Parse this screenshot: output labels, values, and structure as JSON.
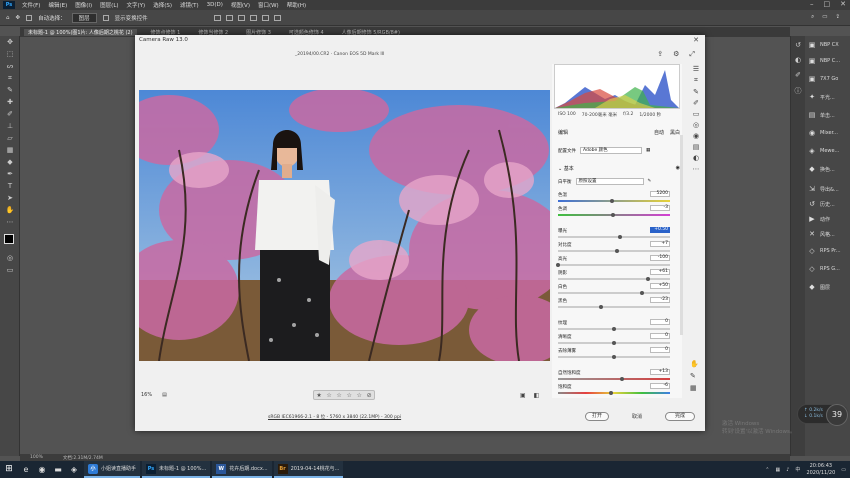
{
  "ps": {
    "menu": [
      "文件(F)",
      "编辑(E)",
      "图像(I)",
      "图层(L)",
      "文字(Y)",
      "选择(S)",
      "滤镜(T)",
      "3D(D)",
      "视图(V)",
      "窗口(W)",
      "帮助(H)"
    ],
    "logo": "Ps",
    "options": {
      "auto_select": "自动选择：",
      "group": "图层",
      "show_transform": "显示变换控件"
    },
    "tabs": [
      "未标题-1 @ 100%(图1片: 人像后期之桃花 (2)",
      "修饰点修饰 1",
      "修饰当修饰 2",
      "图片修饰 3",
      "可选颜色修饰 4",
      "人像后期修饰 5/RGB/8#)"
    ],
    "status": {
      "zoom": "100%",
      "doc": "文档:2.31M/2.74M"
    },
    "panels": [
      "NBP CX",
      "NBP C...",
      "7X7 Go",
      "平光...",
      "单击...",
      "Mixer...",
      "Mewe...",
      "换色...",
      "导出&...",
      "历史...",
      "动作",
      "风格...",
      "RPS Pr...",
      "RPS G...",
      "图层"
    ]
  },
  "acr": {
    "title": "Camera Raw 13.0",
    "subtitle": "_20194/00.CR2  ·  Canon EOS 5D Mark III",
    "meta": [
      "ISO 100",
      "70-200毫米 毫米",
      "f/3.2",
      "1/2000 秒"
    ],
    "edit_label": "编辑",
    "auto_label": "自动",
    "bw_label": "黑白",
    "profile_label": "配置文件",
    "profile_value": "Adobe 颜色",
    "basic_label": "基本",
    "wb_label": "白平衡",
    "wb_value": "原照设置",
    "sliders": {
      "temp": {
        "label": "色温",
        "value": "5200",
        "pos": 0.48
      },
      "tint": {
        "label": "色调",
        "value": "-3",
        "pos": 0.49
      },
      "exposure": {
        "label": "曝光",
        "value": "+0.50",
        "pos": 0.55
      },
      "contrast": {
        "label": "对比度",
        "value": "+7",
        "pos": 0.53
      },
      "highlights": {
        "label": "高光",
        "value": "-100",
        "pos": 0.0
      },
      "shadows": {
        "label": "阴影",
        "value": "+61",
        "pos": 0.8
      },
      "whites": {
        "label": "白色",
        "value": "+50",
        "pos": 0.75
      },
      "blacks": {
        "label": "黑色",
        "value": "-23",
        "pos": 0.38
      },
      "texture": {
        "label": "纹理",
        "value": "0",
        "pos": 0.5
      },
      "clarity": {
        "label": "清晰度",
        "value": "0",
        "pos": 0.5
      },
      "dehaze": {
        "label": "去除薄雾",
        "value": "0",
        "pos": 0.5
      },
      "vibrance": {
        "label": "自然饱和度",
        "value": "+13",
        "pos": 0.57
      },
      "saturation": {
        "label": "饱和度",
        "value": "-6",
        "pos": 0.47
      }
    },
    "zoom": "16%",
    "fileinfo": "sRGB IEC61966-2.1 - 8 位 - 5760 x 3840 (22.1MP) - 300 ppi",
    "open": "打开",
    "cancel": "取消",
    "done": "完成",
    "stars": [
      "★",
      "☆",
      "☆",
      "☆",
      "☆",
      "⊘"
    ]
  },
  "watermark": {
    "line1": "激活 Windows",
    "line2": "转到'设置'以激活 Windows。"
  },
  "net": {
    "up": "↑ 0.2k/s",
    "down": "↓ 0.1k/s",
    "pct": "39"
  },
  "taskbar": {
    "apps": [
      {
        "icon": "小",
        "label": "小姐读直播助手"
      },
      {
        "icon": "Ps",
        "label": "未标题-1 @ 100%..."
      },
      {
        "icon": "W",
        "label": "花卉后期.docx..."
      },
      {
        "icon": "Br",
        "label": "2019-04-14桃花与..."
      }
    ],
    "time": "20:06:43",
    "date": "2020/11/20"
  }
}
